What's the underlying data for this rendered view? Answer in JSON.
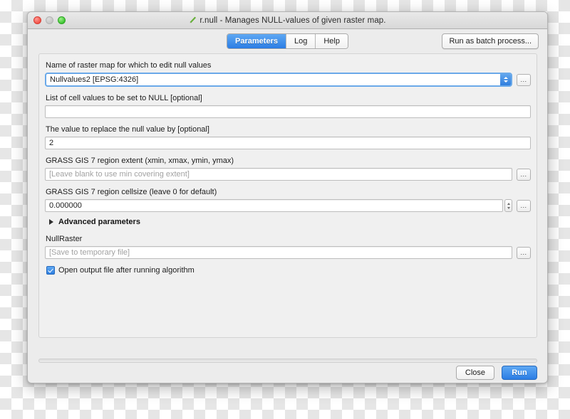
{
  "window": {
    "title": "r.null - Manages NULL-values of given raster map.",
    "title_icon": "grass-pencil-icon",
    "traffic_lights": [
      "close",
      "minimize",
      "zoom"
    ]
  },
  "toolbar": {
    "tabs": [
      {
        "label": "Parameters",
        "active": true
      },
      {
        "label": "Log",
        "active": false
      },
      {
        "label": "Help",
        "active": false
      }
    ],
    "batch_button": "Run as batch process..."
  },
  "parameters": {
    "raster_map": {
      "label": "Name of raster map for which to edit null values",
      "value": "Nullvalues2 [EPSG:4326]",
      "browse": "..."
    },
    "cell_values": {
      "label": "List of cell values to be set to NULL [optional]",
      "value": "",
      "placeholder": ""
    },
    "replace_value": {
      "label": "The value to replace the null value by [optional]",
      "value": "2"
    },
    "region_extent": {
      "label": "GRASS GIS 7 region extent (xmin, xmax, ymin, ymax)",
      "value": "",
      "placeholder": "[Leave blank to use min covering extent]",
      "browse": "..."
    },
    "region_cellsize": {
      "label": "GRASS GIS 7 region cellsize (leave 0 for default)",
      "value": "0.000000",
      "browse": "..."
    },
    "advanced": {
      "label": "Advanced parameters",
      "expanded": false
    },
    "output": {
      "label": "NullRaster",
      "value": "",
      "placeholder": "[Save to temporary file]",
      "browse": "..."
    },
    "open_output": {
      "label": "Open output file after running algorithm",
      "checked": true
    }
  },
  "progress": {
    "value": 0
  },
  "footer": {
    "close_label": "Close",
    "run_label": "Run"
  },
  "colors": {
    "accent": "#2b7de4",
    "focus_ring": "#6aa9e9",
    "window_bg": "#ececec",
    "panel_bg": "#f0f0f0"
  }
}
